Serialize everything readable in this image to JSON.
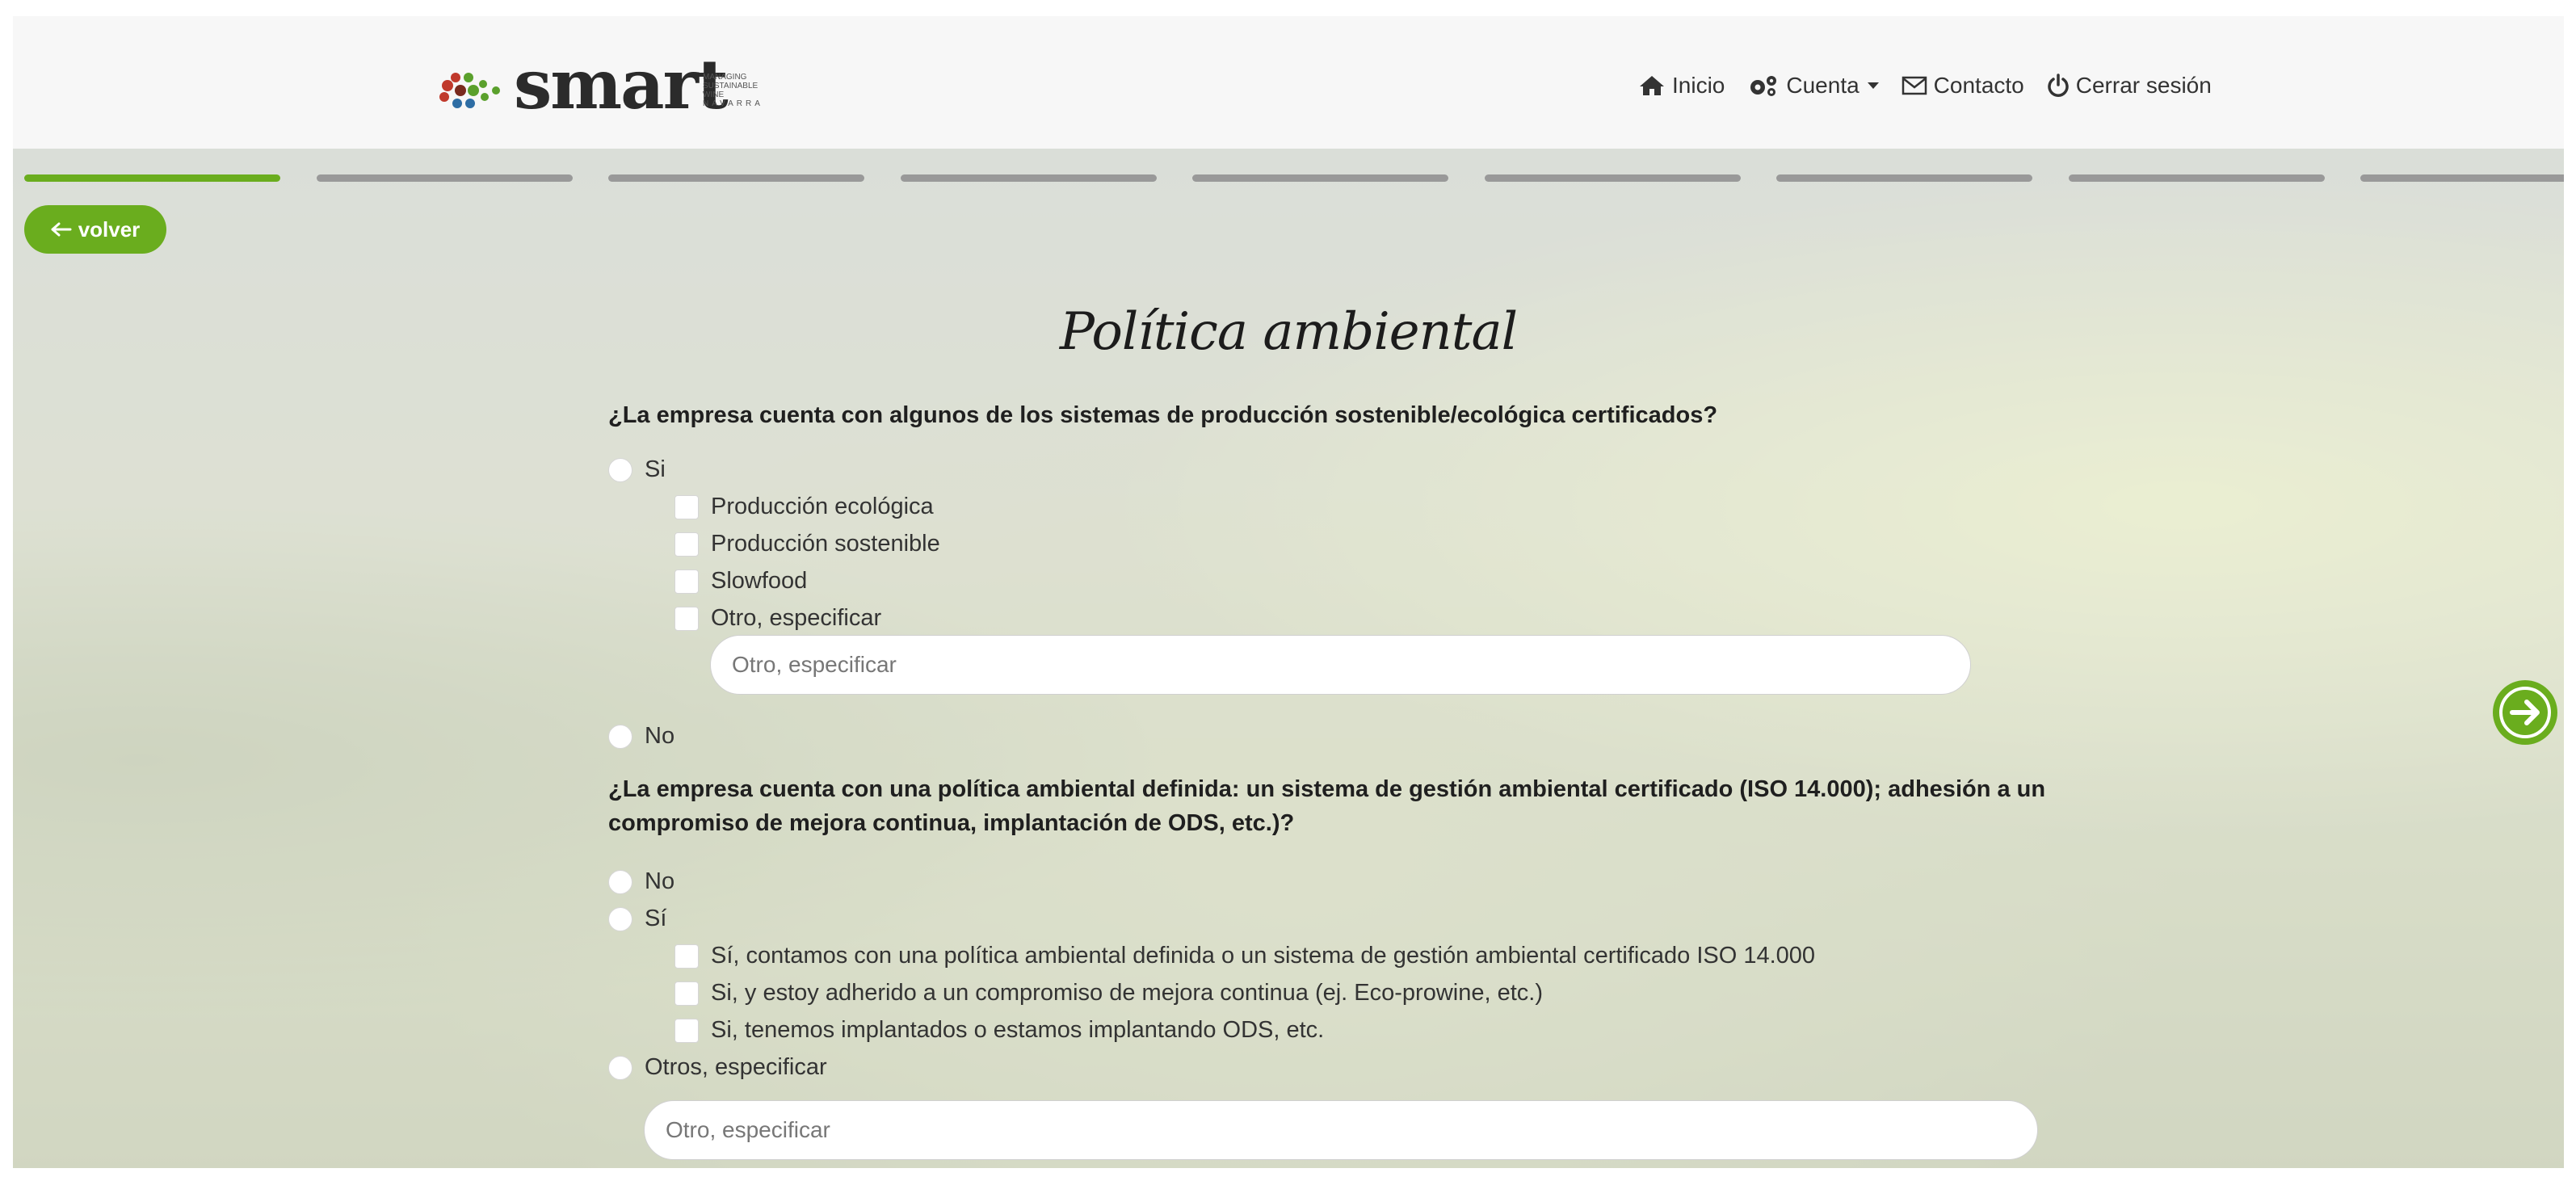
{
  "brand": {
    "logo_text": "smart",
    "tagline": [
      "MANAGING",
      "SUSTAINABLE",
      "WINE",
      "NAVARRA"
    ],
    "colors": {
      "accent_green": "#6aad1e",
      "petal_red": "#c0392b",
      "petal_green": "#5aa02c",
      "petal_blue": "#2e6da4"
    }
  },
  "nav": {
    "items": [
      {
        "icon": "home-icon",
        "label": "Inicio"
      },
      {
        "icon": "gears-icon",
        "label": "Cuenta"
      },
      {
        "icon": "envelope-icon",
        "label": "Contacto"
      },
      {
        "icon": "power-icon",
        "label": "Cerrar sesión"
      }
    ]
  },
  "progress": {
    "total_steps": 9,
    "current_step": 1
  },
  "back_button": {
    "icon": "arrow-left-icon",
    "label": "volver"
  },
  "next_button": {
    "icon": "arrow-right-circle-icon"
  },
  "page": {
    "title": "Política ambiental",
    "q1": {
      "text": "¿La empresa cuenta con algunos de los sistemas de producción sostenible/ecológica certificados?",
      "yes": "Si",
      "checks": [
        "Producción ecológica",
        "Producción sostenible",
        "Slowfood",
        "Otro, especificar"
      ],
      "other_placeholder": "Otro, especificar",
      "no": "No"
    },
    "q2": {
      "text_line1": "¿La empresa cuenta con una política ambiental definida: un sistema de gestión ambiental certificado (ISO 14.000); adhesión a un",
      "text_line2": "compromiso de mejora continua, implantación de ODS, etc.)?",
      "no": "No",
      "yes": "Sí",
      "checks": [
        "Sí, contamos con una política ambiental definida o un sistema de gestión ambiental certificado ISO 14.000",
        "Si, y estoy adherido a un compromiso de mejora continua (ej. Eco-prowine, etc.)",
        "Si, tenemos implantados o estamos implantando ODS, etc."
      ],
      "others": "Otros, especificar",
      "other_placeholder": "Otro, especificar"
    }
  }
}
